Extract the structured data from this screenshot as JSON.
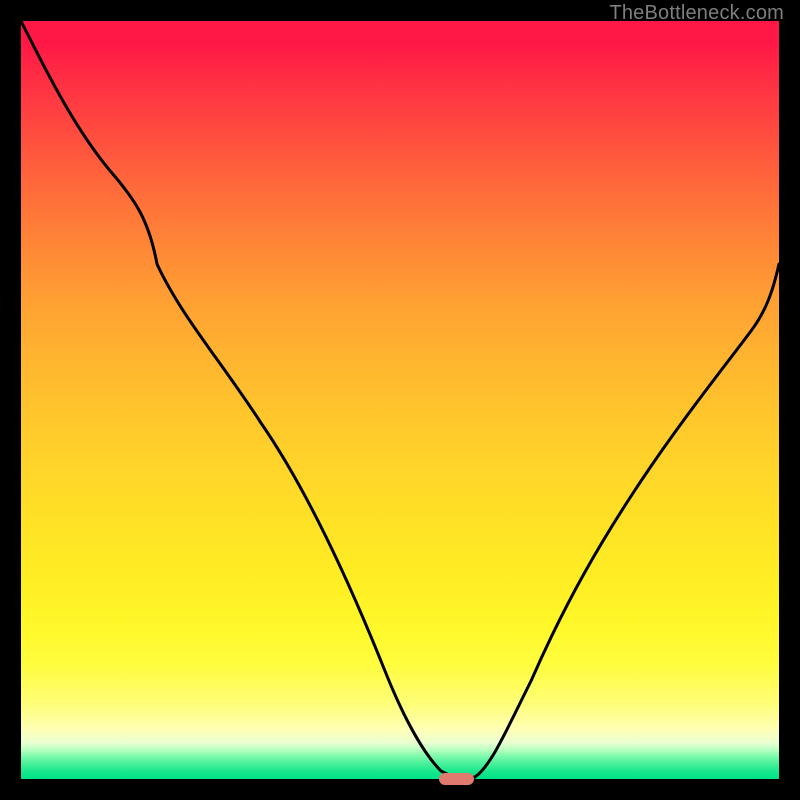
{
  "attribution": "TheBottleneck.com",
  "colors": {
    "curve_stroke": "#000000",
    "marker_fill": "#e0796e",
    "frame_background": "#000000"
  },
  "chart_data": {
    "type": "line",
    "title": "",
    "xlabel": "",
    "ylabel": "",
    "xlim": [
      0,
      100
    ],
    "ylim": [
      0,
      100
    ],
    "series": [
      {
        "name": "bottleneck-curve",
        "x": [
          0,
          6,
          12,
          18,
          24,
          30,
          36,
          42,
          48,
          52,
          55,
          57.5,
          60,
          64,
          70,
          78,
          86,
          94,
          100
        ],
        "y": [
          100,
          90,
          80,
          72,
          68,
          62,
          53,
          41,
          26,
          14,
          5,
          0,
          2,
          10,
          24,
          40,
          53,
          62,
          68
        ]
      }
    ],
    "marker": {
      "x_center": 57.5,
      "y": 0,
      "width_pct": 4.6
    },
    "grid": false,
    "legend": false
  }
}
